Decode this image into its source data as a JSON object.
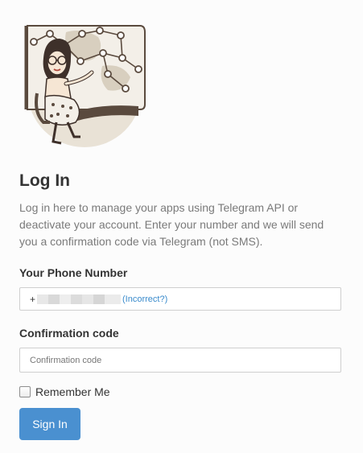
{
  "login": {
    "title": "Log In",
    "description": "Log in here to manage your apps using Telegram API or deactivate your account. Enter your number and we will send you a confirmation code via Telegram (not SMS).",
    "phone_label": "Your Phone Number",
    "phone_prefix": "+",
    "incorrect_link": "(Incorrect?)",
    "code_label": "Confirmation code",
    "code_placeholder": "Confirmation code",
    "code_value": "",
    "remember_label": "Remember Me",
    "remember_checked": false,
    "signin_label": "Sign In"
  },
  "colors": {
    "accent": "#4a90d0",
    "link": "#3a8bcc",
    "background": "#fcfcfc"
  }
}
